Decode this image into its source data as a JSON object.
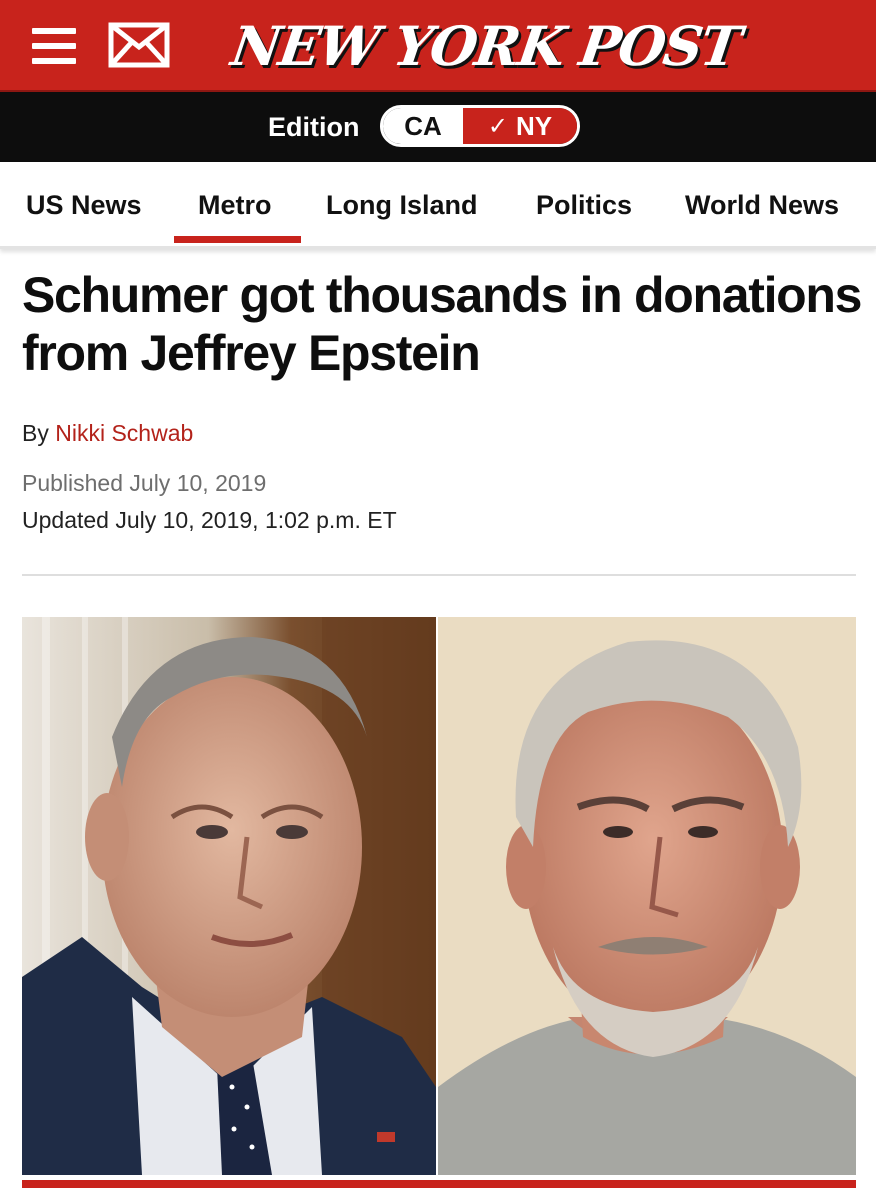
{
  "masthead": {
    "logo_text": "NEW YORK POST",
    "brand_color": "#c8231c",
    "menu_icon": "hamburger-menu-icon",
    "mail_icon": "envelope-icon"
  },
  "edition": {
    "label": "Edition",
    "options": [
      "CA",
      "NY"
    ],
    "selected": "NY",
    "check_glyph": "✓"
  },
  "nav": {
    "items": [
      "US News",
      "Metro",
      "Long Island",
      "Politics",
      "World News"
    ],
    "active": "Metro"
  },
  "article": {
    "headline": "Schumer got thousands in donations from Jeffrey Epstein",
    "byline_prefix": "By",
    "author": "Nikki Schwab",
    "published": "Published July 10, 2019",
    "updated": "Updated July 10, 2019, 1:02 p.m. ET"
  },
  "images": {
    "left_photo": "portrait-photo",
    "right_photo": "portrait-photo"
  }
}
